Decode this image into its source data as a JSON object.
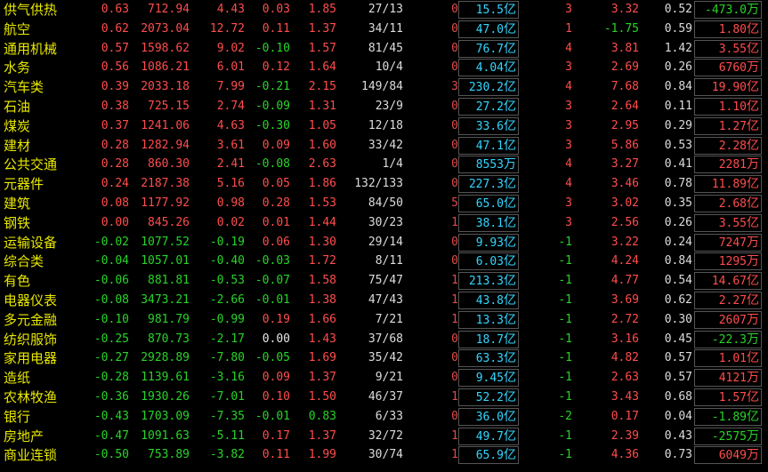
{
  "colors": {
    "up": "#ff4d4d",
    "down": "#28d428",
    "flat": "#e8e8e8",
    "name": "#e8e800",
    "volume": "#33d6ff"
  },
  "rows": [
    {
      "name": "供气供热",
      "v1": "0.63",
      "v2": "712.94",
      "v3": "4.43",
      "v4": "0.03",
      "v5": "1.85",
      "v6": "27/13",
      "v7": "0",
      "v8": "15.5",
      "v8u": "亿",
      "v9": "3",
      "v10": "3.32",
      "v11": "0.52",
      "v12": "-473.0",
      "v12u": "万",
      "c": [
        "up",
        "up",
        "up",
        "up",
        "up",
        "",
        "",
        "",
        "up",
        "up",
        "",
        "down"
      ]
    },
    {
      "name": "航空",
      "v1": "0.62",
      "v2": "2073.04",
      "v3": "12.72",
      "v4": "0.11",
      "v5": "1.37",
      "v6": "34/11",
      "v7": "0",
      "v8": "47.0",
      "v8u": "亿",
      "v9": "1",
      "v10": "-1.75",
      "v11": "0.59",
      "v12": "1.80",
      "v12u": "亿",
      "c": [
        "up",
        "up",
        "up",
        "up",
        "up",
        "",
        "",
        "",
        "up",
        "down",
        "",
        "up"
      ]
    },
    {
      "name": "通用机械",
      "v1": "0.57",
      "v2": "1598.62",
      "v3": "9.02",
      "v4": "-0.10",
      "v5": "1.57",
      "v6": "81/45",
      "v7": "0",
      "v8": "76.7",
      "v8u": "亿",
      "v9": "4",
      "v10": "3.81",
      "v11": "1.42",
      "v12": "3.55",
      "v12u": "亿",
      "c": [
        "up",
        "up",
        "up",
        "down",
        "up",
        "",
        "",
        "",
        "up",
        "up",
        "",
        "up"
      ]
    },
    {
      "name": "水务",
      "v1": "0.56",
      "v2": "1086.21",
      "v3": "6.01",
      "v4": "0.12",
      "v5": "1.64",
      "v6": "10/4",
      "v7": "0",
      "v8": "4.04",
      "v8u": "亿",
      "v9": "3",
      "v10": "2.69",
      "v11": "0.26",
      "v12": "6760",
      "v12u": "万",
      "c": [
        "up",
        "up",
        "up",
        "up",
        "up",
        "",
        "",
        "",
        "up",
        "up",
        "",
        "up"
      ]
    },
    {
      "name": "汽车类",
      "v1": "0.39",
      "v2": "2033.18",
      "v3": "7.99",
      "v4": "-0.21",
      "v5": "2.15",
      "v6": "149/84",
      "v7": "3",
      "v8": "230.2",
      "v8u": "亿",
      "v9": "4",
      "v10": "7.68",
      "v11": "0.84",
      "v12": "19.90",
      "v12u": "亿",
      "c": [
        "up",
        "up",
        "up",
        "down",
        "up",
        "",
        "",
        "",
        "up",
        "up",
        "",
        "up"
      ]
    },
    {
      "name": "石油",
      "v1": "0.38",
      "v2": "725.15",
      "v3": "2.74",
      "v4": "-0.09",
      "v5": "1.31",
      "v6": "23/9",
      "v7": "0",
      "v8": "27.2",
      "v8u": "亿",
      "v9": "3",
      "v10": "2.64",
      "v11": "0.11",
      "v12": "1.10",
      "v12u": "亿",
      "c": [
        "up",
        "up",
        "up",
        "down",
        "up",
        "",
        "",
        "",
        "up",
        "up",
        "",
        "up"
      ]
    },
    {
      "name": "煤炭",
      "v1": "0.37",
      "v2": "1241.06",
      "v3": "4.63",
      "v4": "-0.30",
      "v5": "1.05",
      "v6": "12/18",
      "v7": "0",
      "v8": "33.6",
      "v8u": "亿",
      "v9": "3",
      "v10": "2.95",
      "v11": "0.29",
      "v12": "1.27",
      "v12u": "亿",
      "c": [
        "up",
        "up",
        "up",
        "down",
        "up",
        "",
        "",
        "",
        "up",
        "up",
        "",
        "up"
      ]
    },
    {
      "name": "建材",
      "v1": "0.28",
      "v2": "1282.94",
      "v3": "3.61",
      "v4": "0.09",
      "v5": "1.60",
      "v6": "33/42",
      "v7": "0",
      "v8": "47.1",
      "v8u": "亿",
      "v9": "3",
      "v10": "5.86",
      "v11": "0.53",
      "v12": "2.28",
      "v12u": "亿",
      "c": [
        "up",
        "up",
        "up",
        "up",
        "up",
        "",
        "",
        "",
        "up",
        "up",
        "",
        "up"
      ]
    },
    {
      "name": "公共交通",
      "v1": "0.28",
      "v2": "860.30",
      "v3": "2.41",
      "v4": "-0.08",
      "v5": "2.63",
      "v6": "1/4",
      "v7": "0",
      "v8": "8553",
      "v8u": "万",
      "v9": "4",
      "v10": "3.27",
      "v11": "0.41",
      "v12": "2281",
      "v12u": "万",
      "c": [
        "up",
        "up",
        "up",
        "down",
        "up",
        "",
        "",
        "",
        "up",
        "up",
        "",
        "up"
      ]
    },
    {
      "name": "元器件",
      "v1": "0.24",
      "v2": "2187.38",
      "v3": "5.16",
      "v4": "0.05",
      "v5": "1.86",
      "v6": "132/133",
      "v7": "0",
      "v8": "227.3",
      "v8u": "亿",
      "v9": "4",
      "v10": "3.46",
      "v11": "0.78",
      "v12": "11.89",
      "v12u": "亿",
      "c": [
        "up",
        "up",
        "up",
        "up",
        "up",
        "",
        "",
        "",
        "up",
        "up",
        "",
        "up"
      ]
    },
    {
      "name": "建筑",
      "v1": "0.08",
      "v2": "1177.92",
      "v3": "0.98",
      "v4": "0.28",
      "v5": "1.53",
      "v6": "84/50",
      "v7": "5",
      "v8": "65.0",
      "v8u": "亿",
      "v9": "3",
      "v10": "3.02",
      "v11": "0.35",
      "v12": "2.68",
      "v12u": "亿",
      "c": [
        "up",
        "up",
        "up",
        "up",
        "up",
        "",
        "",
        "",
        "up",
        "up",
        "",
        "up"
      ]
    },
    {
      "name": "钢铁",
      "v1": "0.00",
      "v2": "845.26",
      "v3": "0.02",
      "v4": "0.01",
      "v5": "1.44",
      "v6": "30/23",
      "v7": "1",
      "v8": "38.1",
      "v8u": "亿",
      "v9": "3",
      "v10": "2.56",
      "v11": "0.26",
      "v12": "3.55",
      "v12u": "亿",
      "c": [
        "up",
        "up",
        "up",
        "up",
        "up",
        "",
        "",
        "",
        "up",
        "up",
        "",
        "up"
      ]
    },
    {
      "name": "运输设备",
      "v1": "-0.02",
      "v2": "1077.52",
      "v3": "-0.19",
      "v4": "0.06",
      "v5": "1.30",
      "v6": "29/14",
      "v7": "0",
      "v8": "9.93",
      "v8u": "亿",
      "v9": "-1",
      "v10": "3.22",
      "v11": "0.24",
      "v12": "7247",
      "v12u": "万",
      "c": [
        "down",
        "down",
        "down",
        "up",
        "up",
        "",
        "",
        "",
        "down",
        "up",
        "",
        "up"
      ]
    },
    {
      "name": "综合类",
      "v1": "-0.04",
      "v2": "1057.01",
      "v3": "-0.40",
      "v4": "-0.03",
      "v5": "1.72",
      "v6": "8/11",
      "v7": "0",
      "v8": "6.03",
      "v8u": "亿",
      "v9": "-1",
      "v10": "4.24",
      "v11": "0.84",
      "v12": "1295",
      "v12u": "万",
      "c": [
        "down",
        "down",
        "down",
        "down",
        "up",
        "",
        "",
        "",
        "down",
        "up",
        "",
        "up"
      ]
    },
    {
      "name": "有色",
      "v1": "-0.06",
      "v2": "881.81",
      "v3": "-0.53",
      "v4": "-0.07",
      "v5": "1.58",
      "v6": "75/47",
      "v7": "1",
      "v8": "213.3",
      "v8u": "亿",
      "v9": "-1",
      "v10": "4.77",
      "v11": "0.54",
      "v12": "14.67",
      "v12u": "亿",
      "c": [
        "down",
        "down",
        "down",
        "down",
        "up",
        "",
        "",
        "",
        "down",
        "up",
        "",
        "up"
      ]
    },
    {
      "name": "电器仪表",
      "v1": "-0.08",
      "v2": "3473.21",
      "v3": "-2.66",
      "v4": "-0.01",
      "v5": "1.38",
      "v6": "47/43",
      "v7": "1",
      "v8": "43.8",
      "v8u": "亿",
      "v9": "-1",
      "v10": "3.69",
      "v11": "0.62",
      "v12": "2.27",
      "v12u": "亿",
      "c": [
        "down",
        "down",
        "down",
        "down",
        "up",
        "",
        "",
        "",
        "down",
        "up",
        "",
        "up"
      ]
    },
    {
      "name": "多元金融",
      "v1": "-0.10",
      "v2": "981.79",
      "v3": "-0.99",
      "v4": "0.19",
      "v5": "1.66",
      "v6": "7/21",
      "v7": "1",
      "v8": "13.3",
      "v8u": "亿",
      "v9": "-1",
      "v10": "2.72",
      "v11": "0.30",
      "v12": "2607",
      "v12u": "万",
      "c": [
        "down",
        "down",
        "down",
        "up",
        "up",
        "",
        "",
        "",
        "down",
        "up",
        "",
        "up"
      ]
    },
    {
      "name": "纺织服饰",
      "v1": "-0.25",
      "v2": "870.73",
      "v3": "-2.17",
      "v4": "0.00",
      "v5": "1.43",
      "v6": "37/68",
      "v7": "0",
      "v8": "18.7",
      "v8u": "亿",
      "v9": "-1",
      "v10": "3.16",
      "v11": "0.45",
      "v12": "-22.3",
      "v12u": "万",
      "c": [
        "down",
        "down",
        "down",
        "flat",
        "up",
        "",
        "",
        "",
        "down",
        "up",
        "",
        "down"
      ]
    },
    {
      "name": "家用电器",
      "v1": "-0.27",
      "v2": "2928.89",
      "v3": "-7.80",
      "v4": "-0.05",
      "v5": "1.69",
      "v6": "35/42",
      "v7": "0",
      "v8": "63.3",
      "v8u": "亿",
      "v9": "-1",
      "v10": "4.82",
      "v11": "0.57",
      "v12": "1.01",
      "v12u": "亿",
      "c": [
        "down",
        "down",
        "down",
        "down",
        "up",
        "",
        "",
        "",
        "down",
        "up",
        "",
        "up"
      ]
    },
    {
      "name": "造纸",
      "v1": "-0.28",
      "v2": "1139.61",
      "v3": "-3.16",
      "v4": "0.09",
      "v5": "1.37",
      "v6": "9/21",
      "v7": "0",
      "v8": "9.45",
      "v8u": "亿",
      "v9": "-1",
      "v10": "2.63",
      "v11": "0.57",
      "v12": "4121",
      "v12u": "万",
      "c": [
        "down",
        "down",
        "down",
        "up",
        "up",
        "",
        "",
        "",
        "down",
        "up",
        "",
        "up"
      ]
    },
    {
      "name": "农林牧渔",
      "v1": "-0.36",
      "v2": "1930.26",
      "v3": "-7.01",
      "v4": "0.10",
      "v5": "1.50",
      "v6": "46/37",
      "v7": "1",
      "v8": "52.2",
      "v8u": "亿",
      "v9": "-1",
      "v10": "3.43",
      "v11": "0.68",
      "v12": "1.57",
      "v12u": "亿",
      "c": [
        "down",
        "down",
        "down",
        "up",
        "up",
        "",
        "",
        "",
        "down",
        "up",
        "",
        "up"
      ]
    },
    {
      "name": "银行",
      "v1": "-0.43",
      "v2": "1703.09",
      "v3": "-7.35",
      "v4": "-0.01",
      "v5": "0.83",
      "v6": "6/33",
      "v7": "0",
      "v8": "36.0",
      "v8u": "亿",
      "v9": "-2",
      "v10": "0.17",
      "v11": "0.04",
      "v12": "-1.89",
      "v12u": "亿",
      "c": [
        "down",
        "down",
        "down",
        "down",
        "down",
        "",
        "",
        "",
        "down",
        "up",
        "",
        "down"
      ]
    },
    {
      "name": "房地产",
      "v1": "-0.47",
      "v2": "1091.63",
      "v3": "-5.11",
      "v4": "0.17",
      "v5": "1.37",
      "v6": "32/72",
      "v7": "1",
      "v8": "49.7",
      "v8u": "亿",
      "v9": "-1",
      "v10": "2.39",
      "v11": "0.43",
      "v12": "-2575",
      "v12u": "万",
      "c": [
        "down",
        "down",
        "down",
        "up",
        "up",
        "",
        "",
        "",
        "down",
        "up",
        "",
        "down"
      ]
    },
    {
      "name": "商业连锁",
      "v1": "-0.50",
      "v2": "753.89",
      "v3": "-3.82",
      "v4": "0.11",
      "v5": "1.99",
      "v6": "30/74",
      "v7": "1",
      "v8": "65.9",
      "v8u": "亿",
      "v9": "-1",
      "v10": "4.36",
      "v11": "0.73",
      "v12": "6049",
      "v12u": "万",
      "c": [
        "down",
        "down",
        "down",
        "up",
        "up",
        "",
        "",
        "",
        "down",
        "up",
        "",
        "up"
      ]
    }
  ]
}
